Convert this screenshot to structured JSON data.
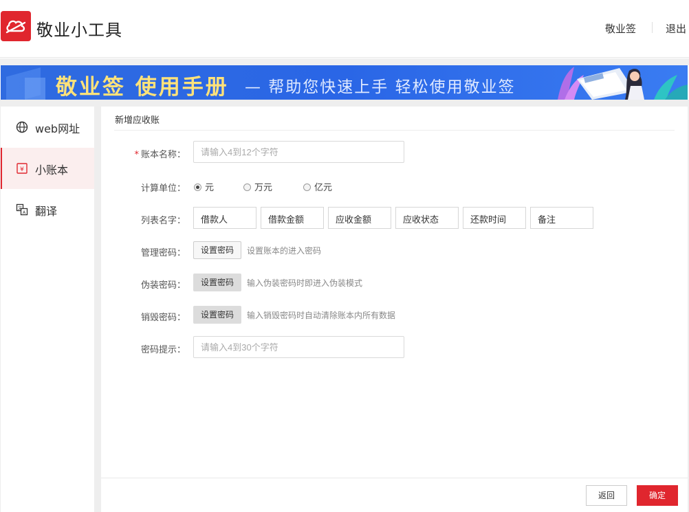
{
  "app": {
    "title": "敬业小工具",
    "brand_color": "#e0262e"
  },
  "header": {
    "links": [
      "敬业签",
      "退出"
    ]
  },
  "banner": {
    "title": "敬业签 使用手册",
    "subtitle": "— 帮助您快速上手  轻松使用敬业签"
  },
  "sidebar": {
    "items": [
      {
        "label": "web网址",
        "icon": "globe-icon"
      },
      {
        "label": "小账本",
        "icon": "ledger-icon",
        "active": true
      },
      {
        "label": "翻译",
        "icon": "translate-icon"
      }
    ]
  },
  "form": {
    "heading": "新增应收账",
    "account_name": {
      "required_mark": "*",
      "label": "账本名称：",
      "placeholder": "请输入4到12个字符"
    },
    "unit": {
      "label": "计算单位：",
      "options": [
        "元",
        "万元",
        "亿元"
      ],
      "selected": "元"
    },
    "columns": {
      "label": "列表名字：",
      "values": [
        "借款人",
        "借款金额",
        "应收金额",
        "应收状态",
        "还款时间",
        "备注"
      ]
    },
    "admin_password": {
      "label": "管理密码：",
      "button": "设置密码",
      "hint": "设置账本的进入密码"
    },
    "disguise_password": {
      "label": "伪装密码：",
      "button": "设置密码",
      "hint": "输入伪装密码时即进入伪装模式"
    },
    "destroy_password": {
      "label": "销毁密码：",
      "button": "设置密码",
      "hint": "输入销毁密码时自动清除账本内所有数据"
    },
    "password_hint": {
      "label": "密码提示：",
      "placeholder": "请输入4到30个字符"
    }
  },
  "footer": {
    "back_label": "返回",
    "confirm_label": "确定"
  }
}
